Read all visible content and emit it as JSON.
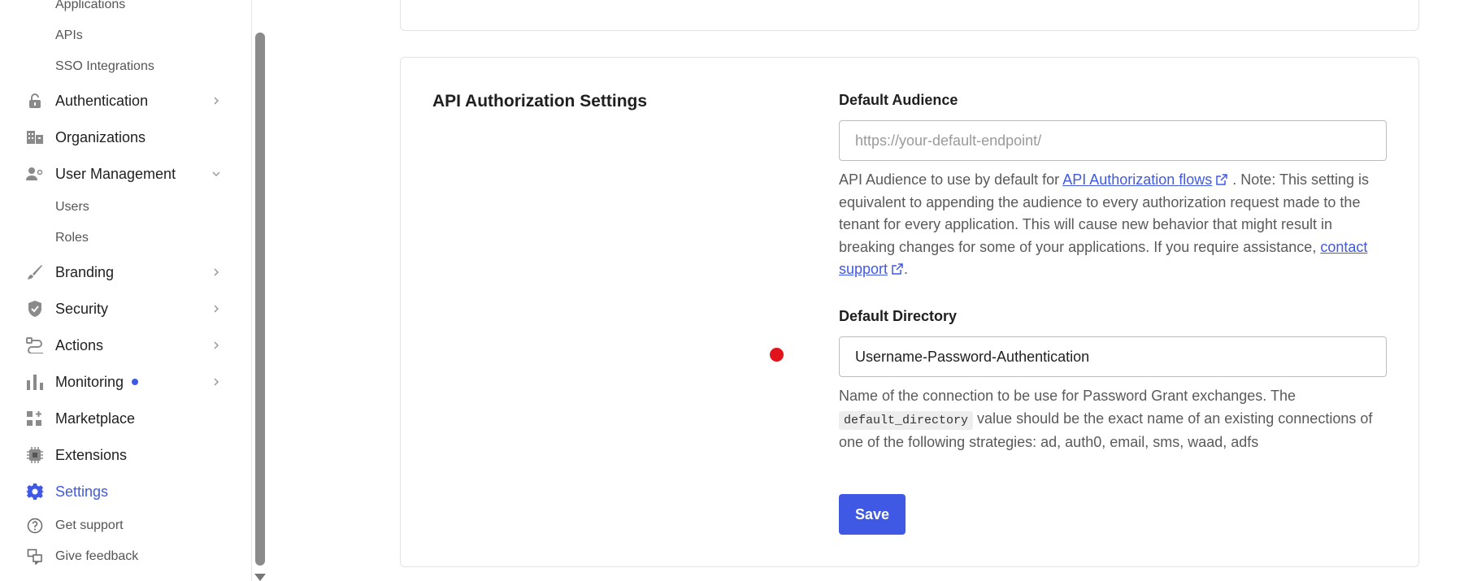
{
  "sidebar": {
    "sub_top": [
      "Applications",
      "APIs",
      "SSO Integrations"
    ],
    "items": [
      {
        "label": "Authentication",
        "icon": "lock-icon"
      },
      {
        "label": "Organizations",
        "icon": "building-icon"
      },
      {
        "label": "User Management",
        "icon": "users-icon",
        "expanded": true
      },
      {
        "label": "Branding",
        "icon": "brush-icon"
      },
      {
        "label": "Security",
        "icon": "shield-icon"
      },
      {
        "label": "Actions",
        "icon": "actions-icon"
      },
      {
        "label": "Monitoring",
        "icon": "chart-icon",
        "notification": true
      },
      {
        "label": "Marketplace",
        "icon": "marketplace-icon"
      },
      {
        "label": "Extensions",
        "icon": "chip-icon"
      },
      {
        "label": "Settings",
        "icon": "gear-icon",
        "active": true
      }
    ],
    "user_mgmt_sub": [
      "Users",
      "Roles"
    ],
    "footer": [
      {
        "label": "Get support",
        "icon": "help-circle-icon"
      },
      {
        "label": "Give feedback",
        "icon": "feedback-icon"
      }
    ]
  },
  "main": {
    "section_title": "API Authorization Settings",
    "default_audience": {
      "label": "Default Audience",
      "placeholder": "https://your-default-endpoint/",
      "value": "",
      "help_prefix": "API Audience to use by default for ",
      "help_link1": "API Authorization flows",
      "help_middle": " . Note: This setting is equivalent to appending the audience to every authorization request made to the tenant for every application. This will cause new behavior that might result in breaking changes for some of your applications. If you require assistance, ",
      "help_link2": "contact support",
      "help_suffix": "."
    },
    "default_directory": {
      "label": "Default Directory",
      "value": "Username-Password-Authentication",
      "help_prefix": "Name of the connection to be use for Password Grant exchanges. The ",
      "help_code": "default_directory",
      "help_suffix": " value should be the exact name of an existing connections of one of the following strategies: ad, auth0, email, sms, waad, adfs"
    },
    "save_label": "Save"
  },
  "colors": {
    "accent": "#3f59e4",
    "marker": "#e0141a"
  }
}
